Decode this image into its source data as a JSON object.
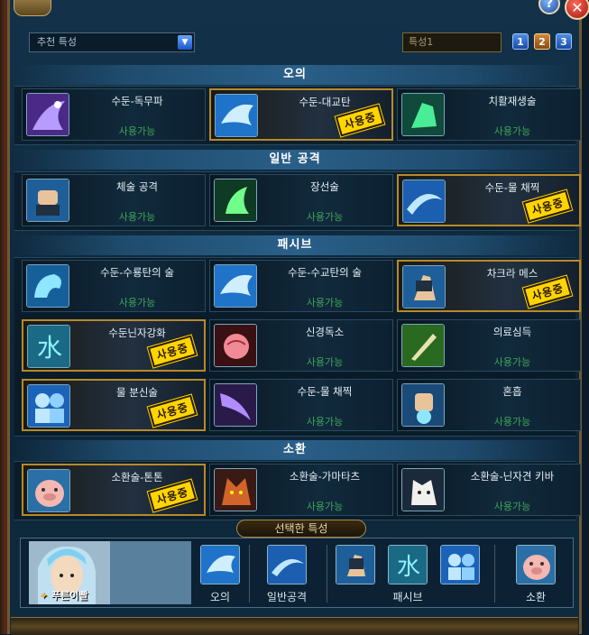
{
  "window": {
    "help_label": "?",
    "close_label": "✕"
  },
  "topbar": {
    "dropdown_value": "추천 특성",
    "dropdown_arrow": "▼",
    "preset_name": "특성1",
    "presets": [
      "1",
      "2",
      "3"
    ],
    "active_preset": "2"
  },
  "sections": [
    {
      "title": "오의",
      "cards": [
        {
          "name": "수둔-독무파",
          "status": "사용가능",
          "in_use": false,
          "icon": "purple-serpent-icon"
        },
        {
          "name": "수둔-대교탄",
          "status": "사용중",
          "in_use": true,
          "icon": "water-shark-icon"
        },
        {
          "name": "치활재생술",
          "status": "사용가능",
          "in_use": false,
          "icon": "green-healing-hand-icon"
        }
      ]
    },
    {
      "title": "일반 공격",
      "cards": [
        {
          "name": "체술 공격",
          "status": "사용가능",
          "in_use": false,
          "icon": "fist-icon"
        },
        {
          "name": "장선술",
          "status": "사용가능",
          "in_use": false,
          "icon": "green-palm-icon"
        },
        {
          "name": "수둔-물 채찍",
          "status": "사용중",
          "in_use": true,
          "icon": "water-whip-icon"
        }
      ]
    },
    {
      "title": "패시브",
      "cards": [
        {
          "name": "수둔-수룡탄의 술",
          "status": "사용가능",
          "in_use": false,
          "icon": "water-dragon-icon"
        },
        {
          "name": "수둔-수교탄의 술",
          "status": "사용가능",
          "in_use": false,
          "icon": "water-shark-icon"
        },
        {
          "name": "차크라 메스",
          "status": "사용중",
          "in_use": true,
          "icon": "chakra-hand-icon"
        },
        {
          "name": "수둔닌자강화",
          "status": "사용중",
          "in_use": true,
          "icon": "water-kanji-icon"
        },
        {
          "name": "신경독소",
          "status": "사용가능",
          "in_use": false,
          "icon": "brain-icon"
        },
        {
          "name": "의료심득",
          "status": "사용가능",
          "in_use": false,
          "icon": "scalpel-icon"
        },
        {
          "name": "물 분신술",
          "status": "사용중",
          "in_use": true,
          "icon": "water-clone-icon"
        },
        {
          "name": "수둔-물 채찍",
          "status": "사용가능",
          "in_use": false,
          "icon": "purple-whip-icon"
        },
        {
          "name": "혼흡",
          "status": "사용가능",
          "in_use": false,
          "icon": "palm-strike-icon"
        }
      ]
    },
    {
      "title": "소환",
      "cards": [
        {
          "name": "소환술-톤톤",
          "status": "사용중",
          "in_use": true,
          "icon": "pig-icon"
        },
        {
          "name": "소환술-가마타츠",
          "status": "사용가능",
          "in_use": false,
          "icon": "fox-icon"
        },
        {
          "name": "소환술-닌자견 키바",
          "status": "사용가능",
          "in_use": false,
          "icon": "white-dog-icon"
        }
      ]
    }
  ],
  "selected": {
    "title": "선택한 특성",
    "character_name": "푸른이빨",
    "groups": [
      {
        "caption": "오의",
        "icons": [
          "water-shark-icon"
        ]
      },
      {
        "caption": "일반공격",
        "icons": [
          "water-whip-icon"
        ]
      },
      {
        "caption": "패시브",
        "icons": [
          "chakra-hand-icon",
          "water-kanji-icon",
          "water-clone-icon"
        ]
      },
      {
        "caption": "소환",
        "icons": [
          "pig-icon"
        ]
      }
    ]
  },
  "colors": {
    "status_available": "#3fa65a",
    "in_use_stamp": "#ffd500",
    "active_border": "#b88a2a"
  }
}
